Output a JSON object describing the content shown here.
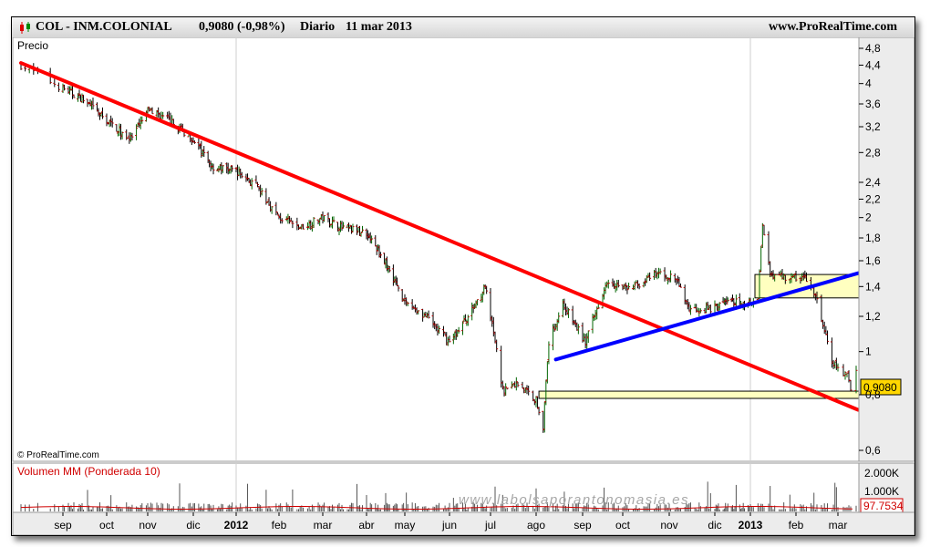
{
  "header": {
    "ticker": "COL - INM.COLONIAL",
    "quote": "0,9080 (-0,98%)",
    "period": "Diario",
    "date": "11 mar 2013",
    "site": "www.ProRealTime.com"
  },
  "price_panel_label": "Precio",
  "copyright": "© ProRealTime.com",
  "volume_panel_label": "Volumen MM (Ponderada 10)",
  "watermark": "www.labolsaporantonomasia.es",
  "current_price_label": "0,9080",
  "volume_avg_label": "97.7534",
  "colors": {
    "trend_down": "#ff0000",
    "trend_up": "#0000ff",
    "zone_fill": "#ffffc0",
    "price_tag": "#ffd700"
  },
  "chart_data": [
    {
      "type": "ohlc",
      "scale": "log",
      "ylim": [
        0.6,
        4.8
      ],
      "yticks": [
        "4,8",
        "4,4",
        "4",
        "3,6",
        "3,2",
        "2,8",
        "2,4",
        "2,2",
        "2",
        "1,8",
        "1,6",
        "1,4",
        "1,2",
        "1",
        "0,8",
        "0,6"
      ],
      "ytick_values": [
        4.8,
        4.4,
        4,
        3.6,
        3.2,
        2.8,
        2.4,
        2.2,
        2,
        1.8,
        1.6,
        1.4,
        1.2,
        1,
        0.8,
        0.6
      ],
      "xticks": [
        "sep",
        "oct",
        "nov",
        "dic",
        "2012",
        "feb",
        "mar",
        "abr",
        "may",
        "jun",
        "jul",
        "ago",
        "sep",
        "oct",
        "nov",
        "dic",
        "2013",
        "feb",
        "mar"
      ],
      "price_series": [
        [
          "2011-08-22",
          4.4
        ],
        [
          "2011-09-01",
          3.9
        ],
        [
          "2011-09-15",
          3.7
        ],
        [
          "2011-10-03",
          3.3
        ],
        [
          "2011-10-20",
          3.0
        ],
        [
          "2011-11-02",
          3.5
        ],
        [
          "2011-11-15",
          3.3
        ],
        [
          "2011-12-01",
          3.0
        ],
        [
          "2011-12-15",
          2.6
        ],
        [
          "2012-01-02",
          2.55
        ],
        [
          "2012-01-16",
          2.35
        ],
        [
          "2012-02-01",
          2.0
        ],
        [
          "2012-02-15",
          1.9
        ],
        [
          "2012-03-01",
          2.0
        ],
        [
          "2012-03-15",
          1.9
        ],
        [
          "2012-04-02",
          1.85
        ],
        [
          "2012-04-16",
          1.6
        ],
        [
          "2012-05-02",
          1.3
        ],
        [
          "2012-05-16",
          1.2
        ],
        [
          "2012-06-01",
          1.05
        ],
        [
          "2012-06-15",
          1.2
        ],
        [
          "2012-06-28",
          1.4
        ],
        [
          "2012-07-05",
          1.05
        ],
        [
          "2012-07-10",
          0.82
        ],
        [
          "2012-07-20",
          0.85
        ],
        [
          "2012-08-01",
          0.78
        ],
        [
          "2012-08-06",
          0.68
        ],
        [
          "2012-08-10",
          1.05
        ],
        [
          "2012-08-20",
          1.28
        ],
        [
          "2012-09-05",
          1.05
        ],
        [
          "2012-09-20",
          1.45
        ],
        [
          "2012-10-05",
          1.38
        ],
        [
          "2012-10-25",
          1.5
        ],
        [
          "2012-11-06",
          1.45
        ],
        [
          "2012-11-15",
          1.25
        ],
        [
          "2012-12-01",
          1.25
        ],
        [
          "2012-12-14",
          1.3
        ],
        [
          "2012-12-27",
          1.28
        ],
        [
          "2013-01-07",
          1.32
        ],
        [
          "2013-01-10",
          1.95
        ],
        [
          "2013-01-15",
          1.5
        ],
        [
          "2013-01-25",
          1.47
        ],
        [
          "2013-02-08",
          1.46
        ],
        [
          "2013-02-15",
          1.3
        ],
        [
          "2013-02-25",
          0.95
        ],
        [
          "2013-03-06",
          0.88
        ],
        [
          "2013-03-08",
          0.83
        ],
        [
          "2013-03-11",
          0.908
        ]
      ],
      "trendlines": [
        {
          "name": "resistance",
          "from": [
            "2011-08-22",
            4.45
          ],
          "to": [
            "2013-03-12",
            0.74
          ]
        },
        {
          "name": "support",
          "from": [
            "2012-08-15",
            0.96
          ],
          "to": [
            "2013-03-12",
            1.5
          ]
        }
      ],
      "zones": [
        {
          "y0": 1.32,
          "y1": 1.49,
          "x0": "2013-01-05"
        },
        {
          "y0": 0.785,
          "y1": 0.815,
          "x0": "2012-08-03"
        }
      ]
    },
    {
      "type": "bar",
      "title": "Volumen MM (Ponderada 10)",
      "yticks": [
        "2.000K",
        "1.000K"
      ],
      "ytick_values": [
        2000,
        1000
      ],
      "last_value": 97.7534
    }
  ]
}
